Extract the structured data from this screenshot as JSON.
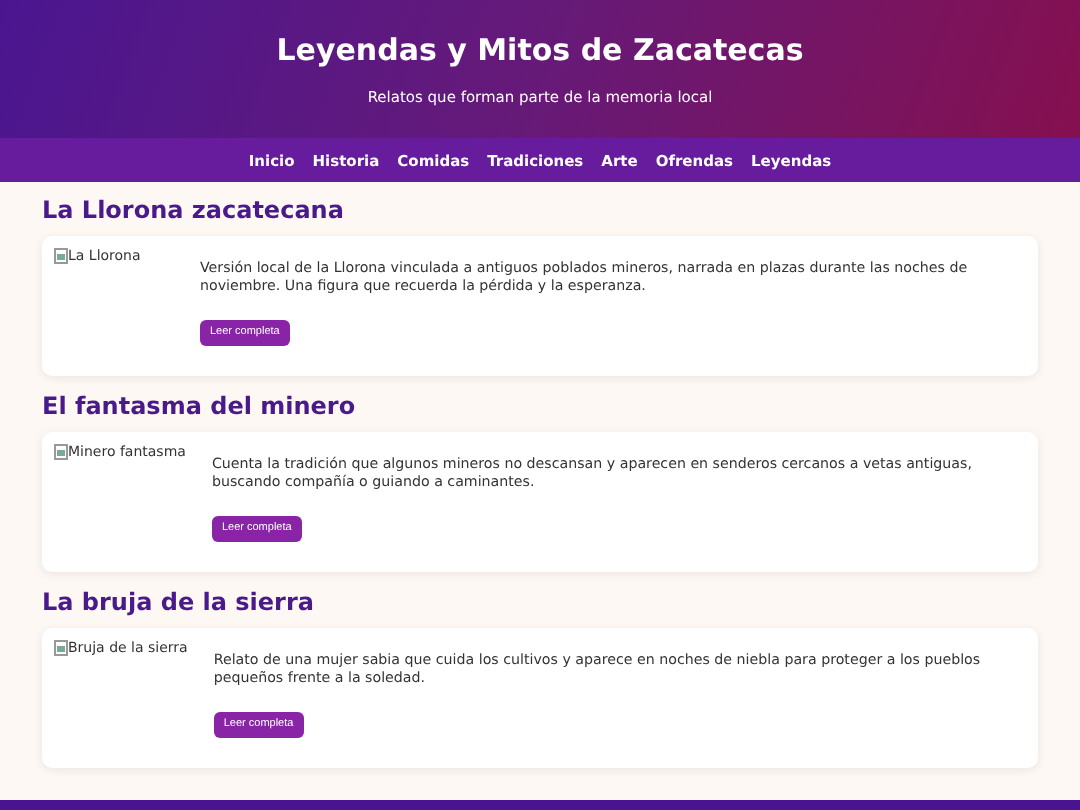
{
  "header": {
    "title": "Leyendas y Mitos de Zacatecas",
    "subtitle": "Relatos que forman parte de la memoria local"
  },
  "nav": [
    "Inicio",
    "Historia",
    "Comidas",
    "Tradiciones",
    "Arte",
    "Ofrendas",
    "Leyendas"
  ],
  "stories": [
    {
      "title": "La Llorona zacatecana",
      "image_alt": "La Llorona",
      "text": "Versión local de la Llorona vinculada a antiguos poblados mineros, narrada en plazas durante las noches de noviembre. Una figura que recuerda la pérdida y la esperanza.",
      "button": "Leer completa"
    },
    {
      "title": "El fantasma del minero",
      "image_alt": "Minero fantasma",
      "text": "Cuenta la tradición que algunos mineros no descansan y aparecen en senderos cercanos a vetas antiguas, buscando compañía o guiando a caminantes.",
      "button": "Leer completa"
    },
    {
      "title": "La bruja de la sierra",
      "image_alt": "Bruja de la sierra",
      "text": "Relato de una mujer sabia que cuida los cultivos y aparece en noches de niebla para proteger a los pueblos pequeños frente a la soledad.",
      "button": "Leer completa"
    }
  ]
}
